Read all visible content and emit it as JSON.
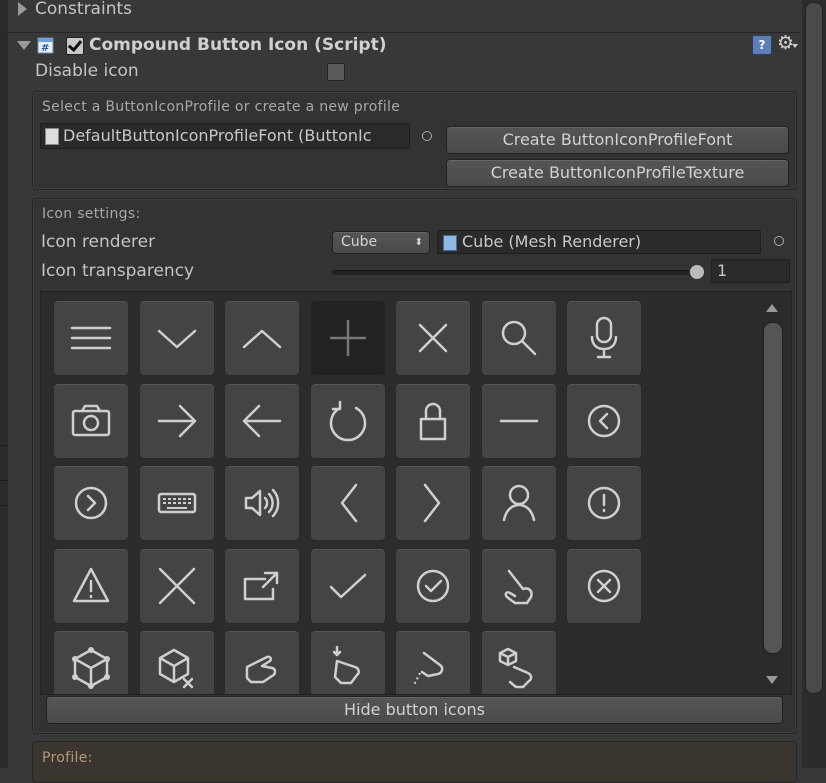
{
  "constraints_label": "Constraints",
  "component": {
    "title": "Compound Button Icon (Script)",
    "enabled": true
  },
  "disable_icon": {
    "label": "Disable icon",
    "checked": false
  },
  "profile_section": {
    "header": "Select a ButtonIconProfile or create a new profile",
    "field_value": "DefaultButtonIconProfileFont (ButtonIc",
    "create_font_label": "Create ButtonIconProfileFont",
    "create_texture_label": "Create ButtonIconProfileTexture"
  },
  "icon_settings": {
    "header": "Icon settings:",
    "renderer_label": "Icon renderer",
    "renderer_dropdown": "Cube",
    "renderer_field": "Cube (Mesh Renderer)",
    "transparency_label": "Icon transparency",
    "transparency_value": "1",
    "transparency_level": 1.0
  },
  "icons": [
    "hamburger-menu-icon",
    "chevron-down-icon",
    "chevron-up-icon",
    "plus-icon",
    "close-icon",
    "search-icon",
    "microphone-icon",
    "camera-icon",
    "arrow-right-icon",
    "arrow-left-icon",
    "refresh-icon",
    "lock-icon",
    "minus-icon",
    "circle-chevron-left-icon",
    "circle-chevron-right-icon",
    "keyboard-icon",
    "speaker-icon",
    "angle-left-icon",
    "angle-right-icon",
    "user-icon",
    "circle-exclamation-icon",
    "warning-triangle-icon",
    "large-x-icon",
    "share-out-icon",
    "checkmark-icon",
    "circle-check-icon",
    "hand-tap-icon",
    "circle-x-icon",
    "cube-nodes-icon",
    "cube-remove-icon",
    "hand-point-icon",
    "hand-tap-down-icon",
    "hand-drag-icon",
    "hand-cube-icon"
  ],
  "selected_icon": "plus-icon",
  "hide_icons_label": "Hide button icons",
  "profile_footer": "Profile:"
}
